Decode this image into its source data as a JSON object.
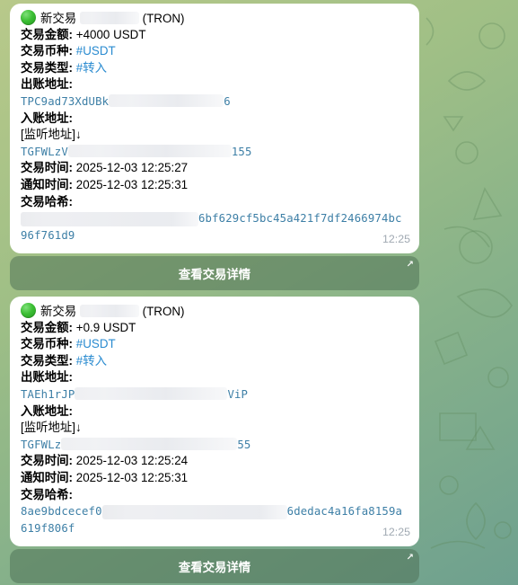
{
  "messages": [
    {
      "title": "新交易",
      "network": "(TRON)",
      "amount_label": "交易金额:",
      "amount_value": " +4000 USDT",
      "coin_label": "交易币种:",
      "coin_value": "#USDT",
      "type_label": "交易类型:",
      "type_value": "#转入",
      "from_label": "出账地址:",
      "from_addr_start": "TPC9ad73XdUBk",
      "from_addr_end": "6",
      "to_label": "入账地址:",
      "monitor_tag": "[监听地址]↓",
      "to_addr_start": "TGFWLzV",
      "to_addr_end": "155",
      "tx_time_label": "交易时间:",
      "tx_time_value": " 2025-12-03 12:25:27",
      "notify_time_label": "通知时间:",
      "notify_time_value": " 2025-12-03 12:25:31",
      "hash_label": "交易哈希:",
      "hash_start": "",
      "hash_mid": "6bf629cf5bc45a421f7df246697",
      "hash_end": "4bc",
      "hash_line2": "96f761d9",
      "timestamp": "12:25",
      "button_label": "查看交易详情"
    },
    {
      "title": "新交易",
      "network": "(TRON)",
      "amount_label": "交易金额:",
      "amount_value": " +0.9 USDT",
      "coin_label": "交易币种:",
      "coin_value": "#USDT",
      "type_label": "交易类型:",
      "type_value": "#转入",
      "from_label": "出账地址:",
      "from_addr_start": "TAEh1rJP",
      "from_addr_end": "ViP",
      "to_label": "入账地址:",
      "monitor_tag": "[监听地址]↓",
      "to_addr_start": "TGFWLz",
      "to_addr_end": "55",
      "tx_time_label": "交易时间:",
      "tx_time_value": " 2025-12-03 12:25:24",
      "notify_time_label": "通知时间:",
      "notify_time_value": " 2025-12-03 12:25:31",
      "hash_label": "交易哈希:",
      "hash_start": "8ae9bdcecef0",
      "hash_mid": "6dedac4a16fa8159",
      "hash_end": "a",
      "hash_line2": "619f806f",
      "timestamp": "12:25",
      "button_label": "查看交易详情"
    }
  ],
  "icons": {
    "status": "green-circle-icon",
    "button_corner": "arrow-up-right-icon"
  },
  "colors": {
    "link": "#2a8bd0",
    "address": "#3d7fa6",
    "status_green": "#3cbf34",
    "time": "#a0a9b2"
  }
}
